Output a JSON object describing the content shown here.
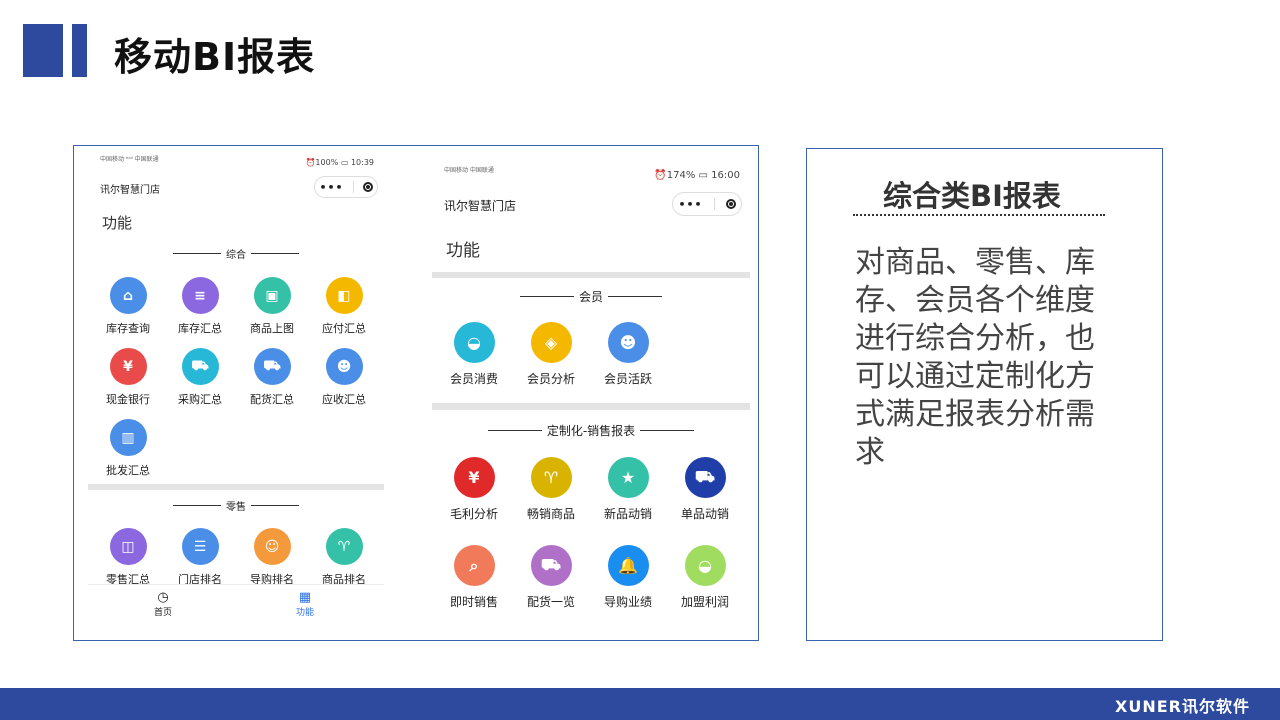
{
  "slide": {
    "title": "移动BI报表"
  },
  "phone1": {
    "status_carrier": "中国移动 ᵉᵃˡˡ 中国联通",
    "status_right": "⏰100% ▭ 10:39",
    "store_name": "讯尔智慧门店",
    "capsule_dots": "•••",
    "func_title": "功能",
    "section1": "综合",
    "row1": [
      {
        "label": "库存查询",
        "icon": "house-search-icon",
        "color": "#4a8ee8",
        "glyph": "⌂"
      },
      {
        "label": "库存汇总",
        "icon": "list-doc-icon",
        "color": "#8b67e0",
        "glyph": "≡"
      },
      {
        "label": "商品上图",
        "icon": "image-icon",
        "color": "#35c0a8",
        "glyph": "▣"
      },
      {
        "label": "应付汇总",
        "icon": "wallet-icon",
        "color": "#f5b800",
        "glyph": "◧"
      }
    ],
    "row2": [
      {
        "label": "现金银行",
        "icon": "cash-yen-icon",
        "color": "#e94b4b",
        "glyph": "¥"
      },
      {
        "label": "采购汇总",
        "icon": "cart-icon",
        "color": "#27b8d8",
        "glyph": "⛟"
      },
      {
        "label": "配货汇总",
        "icon": "delivery-truck-icon",
        "color": "#4a8ee8",
        "glyph": "⛟"
      },
      {
        "label": "应收汇总",
        "icon": "users-icon",
        "color": "#4a8ee8",
        "glyph": "☻"
      }
    ],
    "row3": [
      {
        "label": "批发汇总",
        "icon": "warehouse-icon",
        "color": "#4a8ee8",
        "glyph": "▥"
      }
    ],
    "section2": "零售",
    "row4": [
      {
        "label": "零售汇总",
        "icon": "shopping-bag-icon",
        "color": "#8b67e0",
        "glyph": "◫"
      },
      {
        "label": "门店排名",
        "icon": "store-icon",
        "color": "#4a8ee8",
        "glyph": "☰"
      },
      {
        "label": "导购排名",
        "icon": "guide-card-icon",
        "color": "#f59a3c",
        "glyph": "☺"
      },
      {
        "label": "商品排名",
        "icon": "tshirt-icon",
        "color": "#35c0a8",
        "glyph": "♈"
      }
    ],
    "tab_home": "首页",
    "tab_func": "功能"
  },
  "phone2": {
    "status_carrier": "中国移动 中国联通",
    "status_right": "⏰174% ▭ 16:00",
    "store_name": "讯尔智慧门店",
    "capsule_dots": "•••",
    "func_title": "功能",
    "section1": "会员",
    "row1": [
      {
        "label": "会员消费",
        "icon": "money-bag-icon",
        "color": "#27b8d8",
        "glyph": "◒"
      },
      {
        "label": "会员分析",
        "icon": "diamond-icon",
        "color": "#f5b800",
        "glyph": "◈"
      },
      {
        "label": "会员活跃",
        "icon": "users-icon",
        "color": "#4a8ee8",
        "glyph": "☻"
      }
    ],
    "section2": "定制化-销售报表",
    "row2": [
      {
        "label": "毛利分析",
        "icon": "cash-yen-icon",
        "color": "#e02a2a",
        "glyph": "¥"
      },
      {
        "label": "畅销商品",
        "icon": "tshirt-icon",
        "color": "#d8b400",
        "glyph": "♈"
      },
      {
        "label": "新品动销",
        "icon": "medal-icon",
        "color": "#35c0a8",
        "glyph": "★"
      },
      {
        "label": "单品动销",
        "icon": "truck-icon",
        "color": "#1f3ea8",
        "glyph": "⛟"
      }
    ],
    "row3": [
      {
        "label": "即时销售",
        "icon": "image-search-icon",
        "color": "#f07a5a",
        "glyph": "⌕"
      },
      {
        "label": "配货一览",
        "icon": "delivery-truck-icon",
        "color": "#b070c8",
        "glyph": "⛟"
      },
      {
        "label": "导购业绩",
        "icon": "bell-icon",
        "color": "#1a8ef0",
        "glyph": "🔔"
      },
      {
        "label": "加盟利润",
        "icon": "money-bag-icon",
        "color": "#a0dc60",
        "glyph": "◒"
      }
    ]
  },
  "desc": {
    "title": "综合类BI报表",
    "text": "对商品、零售、库存、会员各个维度进行综合分析，也可以通过定制化方式满足报表分析需求"
  },
  "footer": {
    "brand": "XUNER讯尔软件"
  }
}
